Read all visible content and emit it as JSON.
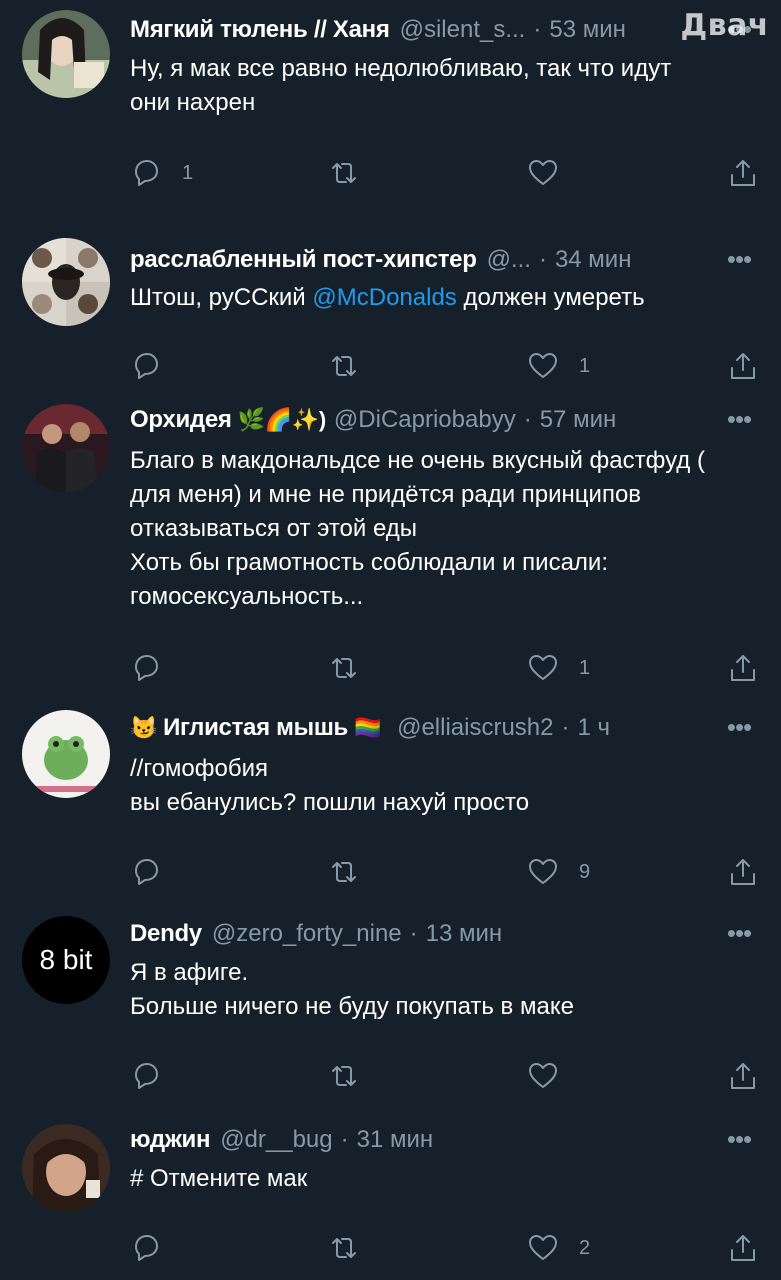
{
  "watermark": "Двач",
  "tweets": [
    {
      "name": "Мягкий тюлень // Ханя",
      "name_emoji_before": "",
      "name_emoji_after": "",
      "handle": "@silent_s...",
      "time": "53 мин",
      "body_pre": "Ну, я мак все равно недолюбливаю, так что идут\nони нахрен",
      "mention": "",
      "body_post": "",
      "reply_count": "1",
      "retweet_count": "",
      "like_count": ""
    },
    {
      "name": "расслабленный пост-хипстер",
      "name_emoji_before": "",
      "name_emoji_after": "",
      "handle": "@...",
      "time": "34 мин",
      "body_pre": "Штош, руССкий ",
      "mention": "@McDonalds",
      "body_post": " должен умереть",
      "reply_count": "",
      "retweet_count": "",
      "like_count": "1"
    },
    {
      "name": "Орхидея",
      "name_emoji_before": "",
      "name_emoji_after": "🌿🌈✨)",
      "handle": "@DiCapriobabyy",
      "time": "57 мин",
      "body_pre": "Благо в макдональдсе не очень вкусный фастфуд (\nдля меня) и мне не придётся ради принципов\nотказываться от этой еды\nХоть бы грамотность соблюдали и писали:\nгомосексуальность...",
      "mention": "",
      "body_post": "",
      "reply_count": "",
      "retweet_count": "",
      "like_count": "1"
    },
    {
      "name": "Иглистая мышь",
      "name_emoji_before": "😼",
      "name_emoji_after": "🏳️‍🌈",
      "handle": "@elliaiscrush2",
      "time": "1 ч",
      "body_pre": "//гомофобия\nвы ебанулись? пошли нахуй просто",
      "mention": "",
      "body_post": "",
      "reply_count": "",
      "retweet_count": "",
      "like_count": "9"
    },
    {
      "name": "Dendy",
      "name_emoji_before": "",
      "name_emoji_after": "",
      "handle": "@zero_forty_nine",
      "time": "13 мин",
      "avatar_text": "8 bit",
      "body_pre": "Я в афиге.\nБольше ничего не буду покупать в маке",
      "mention": "",
      "body_post": "",
      "reply_count": "",
      "retweet_count": "",
      "like_count": ""
    },
    {
      "name": "юджин",
      "name_emoji_before": "",
      "name_emoji_after": "",
      "handle": "@dr__bug",
      "time": "31 мин",
      "body_pre": "# Отмените мак",
      "mention": "",
      "body_post": "",
      "reply_count": "",
      "retweet_count": "",
      "like_count": "2"
    }
  ],
  "colors": {
    "background": "#15202b",
    "text": "#ffffff",
    "muted": "#8899a6",
    "link": "#1d9bf0"
  },
  "icons": [
    "reply-icon",
    "retweet-icon",
    "like-icon",
    "share-icon",
    "more-icon"
  ]
}
